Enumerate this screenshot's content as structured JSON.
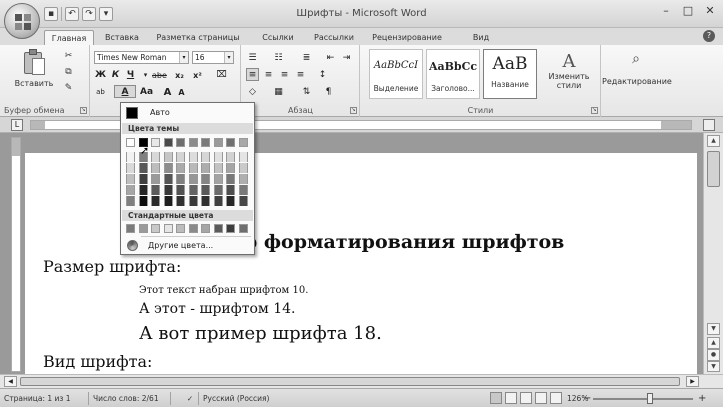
{
  "window": {
    "title": "Шрифты - Microsoft Word"
  },
  "tabs": [
    "Главная",
    "Вставка",
    "Разметка страницы",
    "Ссылки",
    "Рассылки",
    "Рецензирование",
    "Вид"
  ],
  "ribbon": {
    "clipboard": {
      "paste_label": "Вставить",
      "group_label": "Буфер обмена"
    },
    "font": {
      "font_name": "Times New Roman",
      "font_size": "16",
      "bold": "Ж",
      "italic": "К",
      "underline": "Ч",
      "strike": "abe",
      "subscript": "x₂",
      "superscript": "x²",
      "case": "Aa",
      "grow": "A",
      "shrink": "A",
      "font_color": "A"
    },
    "paragraph": {
      "group_label": "Абзац"
    },
    "styles": {
      "group_label": "Стили",
      "items": [
        {
          "sample": "AaBbCcI",
          "name": "Выделение"
        },
        {
          "sample": "AaBbCc",
          "name": "Заголово..."
        },
        {
          "sample": "AaB",
          "name": "Название"
        }
      ],
      "change_styles_label": "Изменить стили"
    },
    "editing": {
      "label": "Редактирование"
    }
  },
  "color_dropdown": {
    "auto_label": "Авто",
    "theme_header": "Цвета темы",
    "standard_header": "Стандартные цвета",
    "more_label": "Другие цвета...",
    "theme_top_row": [
      "#ffffff",
      "#000000",
      "#e8e8e8",
      "#4a4a4a",
      "#6e6e6e",
      "#8c8c8c",
      "#7a7a7a",
      "#9a9a9a",
      "#707070",
      "#a8a8a8"
    ],
    "theme_columns": [
      [
        "#f2f2f2",
        "#d9d9d9",
        "#bfbfbf",
        "#a6a6a6",
        "#808080"
      ],
      [
        "#7f7f7f",
        "#595959",
        "#3f3f3f",
        "#262626",
        "#0d0d0d"
      ],
      [
        "#d8d8d8",
        "#bdbdbd",
        "#9a9a9a",
        "#5c5c5c",
        "#2a2a2a"
      ],
      [
        "#c6c6c6",
        "#8d8d8d",
        "#555555",
        "#383838",
        "#1c1c1c"
      ],
      [
        "#d4d4d4",
        "#aaaaaa",
        "#808080",
        "#525252",
        "#303030"
      ],
      [
        "#dcdcdc",
        "#b9b9b9",
        "#969696",
        "#646464",
        "#3a3a3a"
      ],
      [
        "#d6d6d6",
        "#adadad",
        "#858585",
        "#5a5a5a",
        "#2f2f2f"
      ],
      [
        "#e0e0e0",
        "#c2c2c2",
        "#a3a3a3",
        "#6c6c6c",
        "#404040"
      ],
      [
        "#d2d2d2",
        "#a5a5a5",
        "#787878",
        "#4e4e4e",
        "#272727"
      ],
      [
        "#e4e4e4",
        "#cacaca",
        "#afafaf",
        "#7a7a7a",
        "#474747"
      ]
    ],
    "standard_colors": [
      "#7a7a7a",
      "#9a9a9a",
      "#c8c8c8",
      "#e6e6e6",
      "#bcbcbc",
      "#8a8a8a",
      "#a6a6a6",
      "#5a5a5a",
      "#3c3c3c",
      "#6e6e6e"
    ]
  },
  "document": {
    "heading_visible": "р форматирования шрифтов",
    "size_heading": "Размер шрифта:",
    "line10": "Этот текст набран шрифтом 10.",
    "line14": "А этот - шрифтом 14.",
    "line18": "А вот пример шрифта 18.",
    "type_heading": "Вид шрифта:"
  },
  "status": {
    "page": "Страница: 1 из 1",
    "words": "Число слов: 2/61",
    "language": "Русский (Россия)",
    "zoom": "126%",
    "zoom_minus": "−",
    "zoom_plus": "+"
  }
}
